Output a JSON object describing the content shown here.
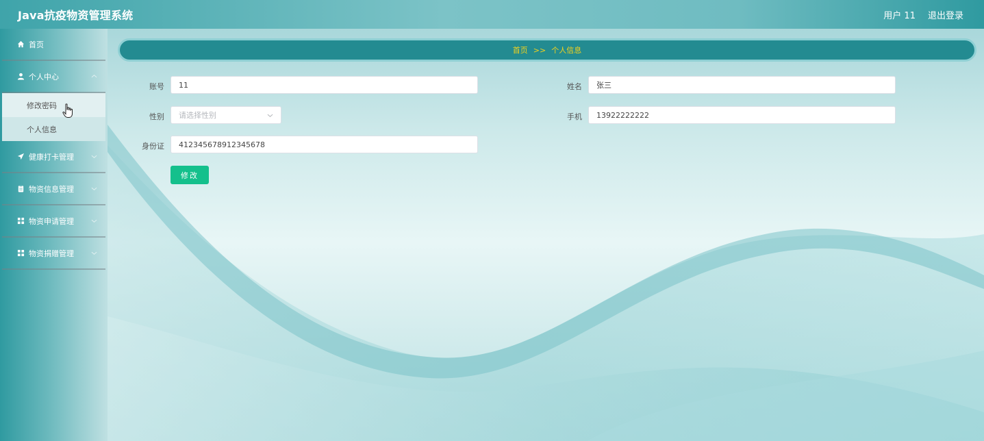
{
  "header": {
    "app_title": "Java抗疫物资管理系统",
    "user_label": "用户 11",
    "logout_label": "退出登录"
  },
  "sidebar": {
    "items": [
      {
        "label": "首页",
        "icon": "home-icon"
      },
      {
        "label": "个人中心",
        "icon": "user-icon",
        "expanded": true,
        "children": [
          {
            "label": "修改密码"
          },
          {
            "label": "个人信息"
          }
        ]
      },
      {
        "label": "健康打卡管理",
        "icon": "send-icon"
      },
      {
        "label": "物资信息管理",
        "icon": "clipboard-icon"
      },
      {
        "label": "物资申请管理",
        "icon": "grid-icon"
      },
      {
        "label": "物资捐赠管理",
        "icon": "grid-icon"
      }
    ]
  },
  "breadcrumb": {
    "home": "首页",
    "separator": ">>",
    "current": "个人信息"
  },
  "form": {
    "account_label": "账号",
    "account_value": "11",
    "name_label": "姓名",
    "name_value": "张三",
    "gender_label": "性别",
    "gender_placeholder": "请选择性别",
    "phone_label": "手机",
    "phone_value": "13922222222",
    "id_label": "身份证",
    "id_value": "412345678912345678",
    "submit_label": "修改"
  },
  "colors": {
    "header_accent": "#3fa4aa",
    "breadcrumb_bg": "#238b91",
    "breadcrumb_text": "#f3d21c",
    "submit_button": "#14c08c"
  }
}
